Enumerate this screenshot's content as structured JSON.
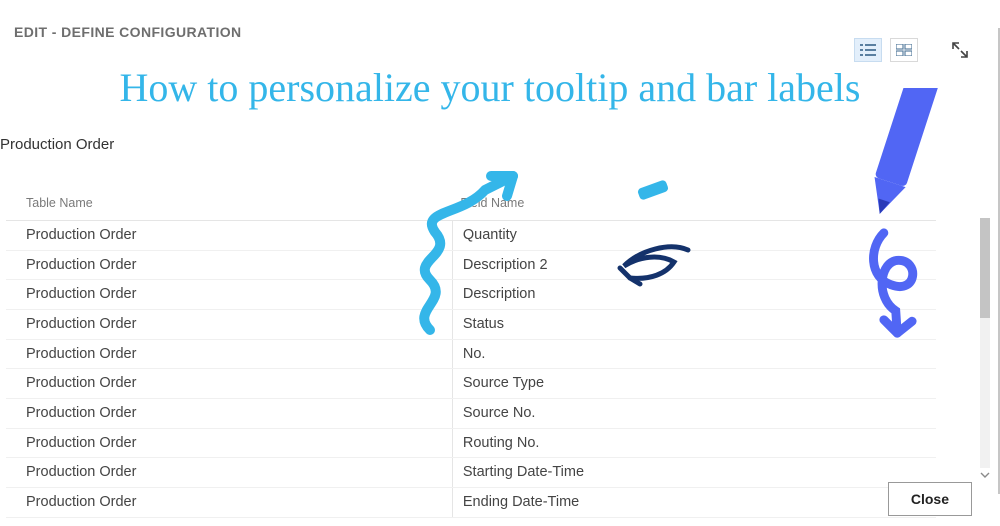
{
  "header": {
    "title": "EDIT - DEFINE CONFIGURATION"
  },
  "subtitle": "Production Order",
  "annotation": {
    "text": "How to personalize your tooltip and bar labels"
  },
  "table": {
    "headers": {
      "table_name": "Table Name",
      "field_name": "Field Name"
    },
    "rows": [
      {
        "table": "Production Order",
        "field": "Quantity"
      },
      {
        "table": "Production Order",
        "field": "Description 2"
      },
      {
        "table": "Production Order",
        "field": "Description"
      },
      {
        "table": "Production Order",
        "field": "Status"
      },
      {
        "table": "Production Order",
        "field": "No."
      },
      {
        "table": "Production Order",
        "field": "Source Type"
      },
      {
        "table": "Production Order",
        "field": "Source No."
      },
      {
        "table": "Production Order",
        "field": "Routing No."
      },
      {
        "table": "Production Order",
        "field": "Starting Date-Time"
      },
      {
        "table": "Production Order",
        "field": "Ending Date-Time"
      }
    ]
  },
  "footer": {
    "close_label": "Close"
  }
}
